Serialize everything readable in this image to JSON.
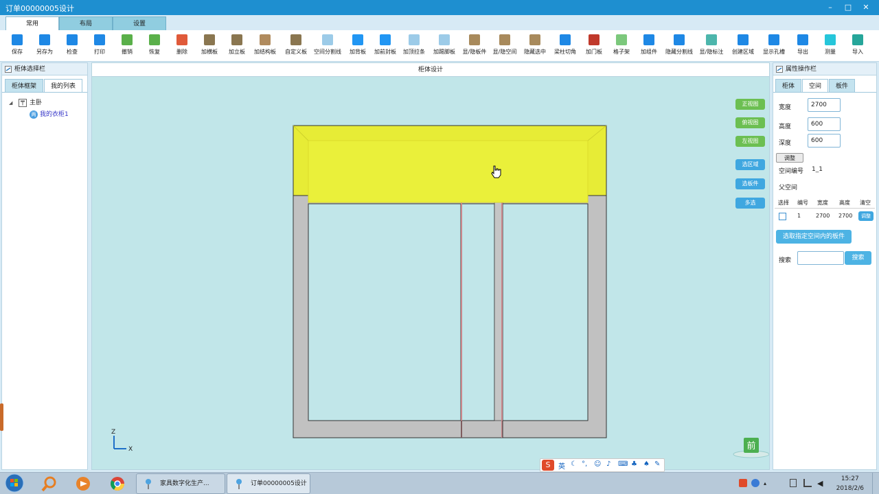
{
  "window": {
    "title": "订单00000005设计",
    "controls": [
      "–",
      "□",
      "✕"
    ]
  },
  "ribbon_tabs": [
    {
      "label": "常用",
      "active": true
    },
    {
      "label": "布局",
      "active": false
    },
    {
      "label": "设置",
      "active": false
    }
  ],
  "toolbar": [
    {
      "label": "保存",
      "icon": "save-icon",
      "color": "#1e88e5"
    },
    {
      "label": "另存为",
      "icon": "save-as-icon",
      "color": "#1e88e5"
    },
    {
      "label": "检查",
      "icon": "check-icon",
      "color": "#1e88e5"
    },
    {
      "label": "打印",
      "icon": "print-icon",
      "color": "#1e88e5"
    },
    {
      "label": "撤销",
      "icon": "undo-icon",
      "color": "#5ab04a"
    },
    {
      "label": "恢复",
      "icon": "redo-icon",
      "color": "#5ab04a"
    },
    {
      "label": "删除",
      "icon": "delete-icon",
      "color": "#e05a3a"
    },
    {
      "label": "加横板",
      "icon": "horizontal-board-icon",
      "color": "#8a7650"
    },
    {
      "label": "加立板",
      "icon": "vertical-board-icon",
      "color": "#8a7650"
    },
    {
      "label": "加结构板",
      "icon": "structure-board-icon",
      "color": "#b08b5e"
    },
    {
      "label": "自定义板",
      "icon": "custom-board-icon",
      "color": "#8a7650"
    },
    {
      "label": "空间分割线",
      "icon": "space-divider-icon",
      "color": "#9ccbe8"
    },
    {
      "label": "加背板",
      "icon": "back-board-icon",
      "color": "#2196f3"
    },
    {
      "label": "加前封板",
      "icon": "front-seal-icon",
      "color": "#2196f3"
    },
    {
      "label": "加顶拉条",
      "icon": "top-strip-icon",
      "color": "#9ccbe8"
    },
    {
      "label": "加踢脚板",
      "icon": "kick-board-icon",
      "color": "#9ccbe8"
    },
    {
      "label": "显/隐板件",
      "icon": "toggle-board-icon",
      "color": "#a88a5c"
    },
    {
      "label": "显/隐空间",
      "icon": "toggle-space-icon",
      "color": "#a88a5c"
    },
    {
      "label": "隐藏选中",
      "icon": "hide-selected-icon",
      "color": "#a88a5c"
    },
    {
      "label": "梁柱切角",
      "icon": "beam-cut-icon",
      "color": "#1e88e5"
    },
    {
      "label": "加门板",
      "icon": "door-panel-icon",
      "color": "#c0392b"
    },
    {
      "label": "格子架",
      "icon": "grid-rack-icon",
      "color": "#7cc87c"
    },
    {
      "label": "加组件",
      "icon": "add-component-icon",
      "color": "#1e88e5"
    },
    {
      "label": "隐藏分割线",
      "icon": "hide-divider-icon",
      "color": "#1e88e5"
    },
    {
      "label": "显/隐标注",
      "icon": "toggle-annotation-icon",
      "color": "#4db6ac"
    },
    {
      "label": "创建区域",
      "icon": "create-region-icon",
      "color": "#1e88e5"
    },
    {
      "label": "显示孔槽",
      "icon": "show-holes-icon",
      "color": "#1e88e5"
    },
    {
      "label": "导出",
      "icon": "export-icon",
      "color": "#1e88e5"
    },
    {
      "label": "测量",
      "icon": "measure-icon",
      "color": "#26c6da"
    },
    {
      "label": "导入",
      "icon": "import-icon",
      "color": "#26a69a"
    }
  ],
  "left_panel": {
    "title": "柜体选择栏",
    "tabs": [
      {
        "label": "柜体框架",
        "active": false
      },
      {
        "label": "我的列表",
        "active": true
      }
    ],
    "tree": {
      "root_label": "主卧",
      "child_label": "我的衣柜1",
      "child_badge": "两"
    }
  },
  "canvas": {
    "title": "柜体设计",
    "view_buttons": [
      "正视图",
      "俯视图",
      "左视图"
    ],
    "select_buttons": [
      "选区域",
      "选板件",
      "多选"
    ],
    "axis": {
      "z": "Z",
      "x": "X"
    },
    "view_badge": "前"
  },
  "right_panel": {
    "title": "属性操作栏",
    "tabs": [
      {
        "label": "柜体",
        "active": false
      },
      {
        "label": "空间",
        "active": true
      },
      {
        "label": "板件",
        "active": false
      }
    ],
    "width_label": "宽度",
    "width_value": "2700",
    "height_label": "高度",
    "height_value": "600",
    "depth_label": "深度",
    "depth_value": "600",
    "adjust_button": "调整",
    "space_id_label": "空间编号",
    "space_id_value": "1_1",
    "parent_label": "父空间",
    "table_headers": [
      "选择",
      "编号",
      "宽度",
      "高度",
      "清空"
    ],
    "table_row": {
      "id": "1",
      "width": "2700",
      "height": "2700",
      "action": "调整"
    },
    "select_boards_button": "选取指定空间内的板件",
    "search_label": "搜索",
    "search_value": "",
    "search_button": "搜索"
  },
  "ime_bar": {
    "lang": "英"
  },
  "taskbar": {
    "apps": [
      {
        "label": "家具数字化生产...",
        "icon": "pin-icon"
      },
      {
        "label": "订单00000005设计",
        "icon": "pin-icon"
      }
    ],
    "time": "15:27",
    "date": "2018/2/6"
  }
}
